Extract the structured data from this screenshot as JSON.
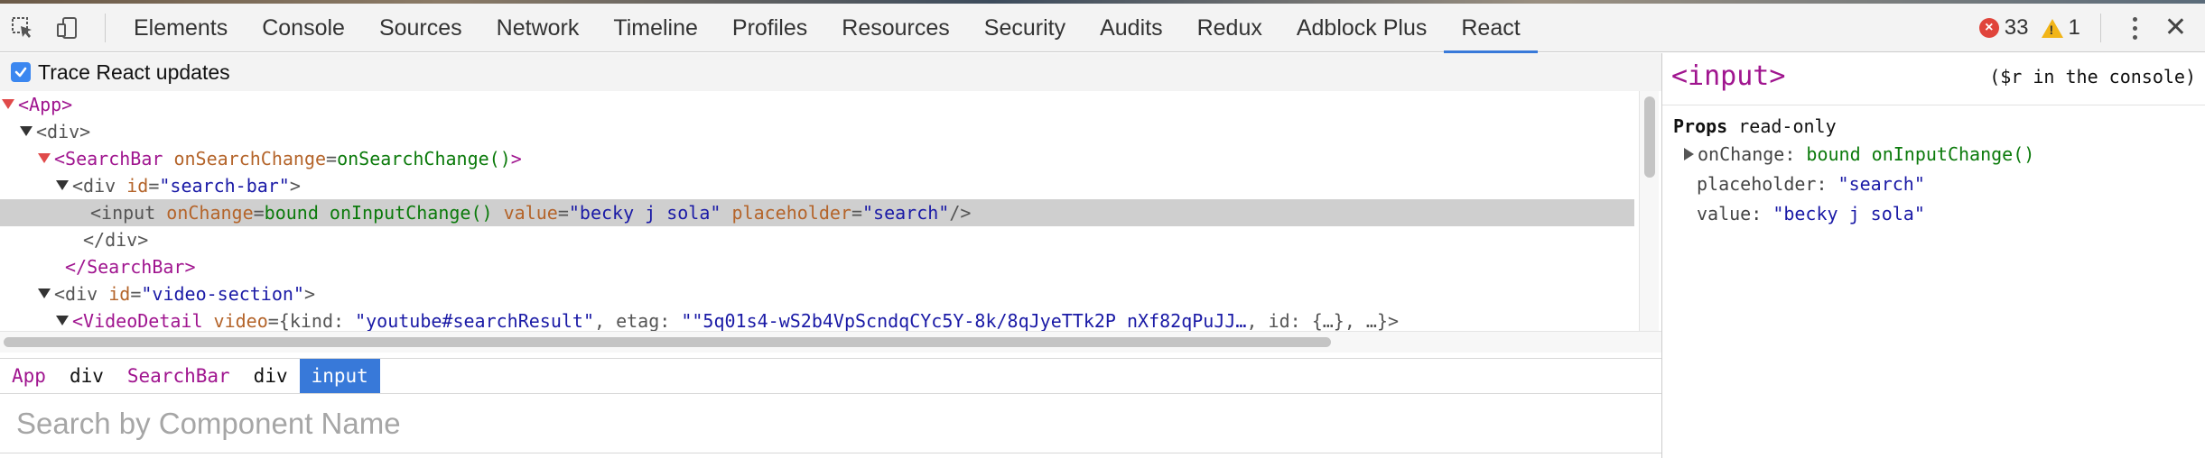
{
  "toolbar": {
    "tabs": [
      "Elements",
      "Console",
      "Sources",
      "Network",
      "Timeline",
      "Profiles",
      "Resources",
      "Security",
      "Audits",
      "Redux",
      "Adblock Plus",
      "React"
    ],
    "active_tab": "React",
    "error_count": "33",
    "warning_count": "1",
    "accent_color": "#3879d9"
  },
  "trace": {
    "label": "Trace React updates",
    "checked": true
  },
  "tree": {
    "nodes": [
      {
        "depth": 0,
        "arrow": "red",
        "parts": [
          [
            "tag",
            "<App>"
          ]
        ]
      },
      {
        "depth": 1,
        "arrow": "dark",
        "parts": [
          [
            "tagplain",
            "<div>"
          ]
        ]
      },
      {
        "depth": 2,
        "arrow": "red",
        "parts": [
          [
            "tag",
            "<SearchBar"
          ],
          [
            "sp",
            " "
          ],
          [
            "attr",
            "onSearchChange"
          ],
          [
            "punct",
            "="
          ],
          [
            "fn",
            "onSearchChange()"
          ],
          [
            "tag",
            ">"
          ]
        ]
      },
      {
        "depth": 3,
        "arrow": "dark",
        "parts": [
          [
            "tagplain",
            "<div"
          ],
          [
            "sp",
            " "
          ],
          [
            "attr",
            "id"
          ],
          [
            "punct",
            "="
          ],
          [
            "str",
            "\"search-bar\""
          ],
          [
            "tagplain",
            ">"
          ]
        ]
      },
      {
        "depth": 4,
        "arrow": "none",
        "selected": true,
        "parts": [
          [
            "tagplain",
            "<input"
          ],
          [
            "sp",
            " "
          ],
          [
            "attr",
            "onChange"
          ],
          [
            "punct",
            "="
          ],
          [
            "fn",
            "bound onInputChange()"
          ],
          [
            "sp",
            " "
          ],
          [
            "attr",
            "value"
          ],
          [
            "punct",
            "="
          ],
          [
            "str",
            "\"becky j sola\""
          ],
          [
            "sp",
            " "
          ],
          [
            "attr",
            "placeholder"
          ],
          [
            "punct",
            "="
          ],
          [
            "str",
            "\"search\""
          ],
          [
            "tagplain",
            "/>"
          ]
        ]
      },
      {
        "depth": 3.6,
        "arrow": "none",
        "parts": [
          [
            "tagplain",
            "</div>"
          ]
        ]
      },
      {
        "depth": 2.6,
        "arrow": "none",
        "parts": [
          [
            "tag",
            "</SearchBar>"
          ]
        ]
      },
      {
        "depth": 2,
        "arrow": "dark",
        "parts": [
          [
            "tagplain",
            "<div"
          ],
          [
            "sp",
            " "
          ],
          [
            "attr",
            "id"
          ],
          [
            "punct",
            "="
          ],
          [
            "str",
            "\"video-section\""
          ],
          [
            "tagplain",
            ">"
          ]
        ]
      },
      {
        "depth": 3,
        "arrow": "dark",
        "parts": [
          [
            "tag",
            "<VideoDetail"
          ],
          [
            "sp",
            " "
          ],
          [
            "attr",
            "video"
          ],
          [
            "punct",
            "={kind: "
          ],
          [
            "str",
            "\"youtube#searchResult\""
          ],
          [
            "punct",
            ", etag: "
          ],
          [
            "str",
            "\"\"5q01s4-wS2b4VpScndqCYc5Y-8k/8qJyeTTk2P_nXf82qPuJJ…"
          ],
          [
            "punct",
            ", id: {…}, …}>"
          ]
        ]
      }
    ]
  },
  "breadcrumb": [
    {
      "label": "App",
      "kind": "comp"
    },
    {
      "label": "div",
      "kind": "dom"
    },
    {
      "label": "SearchBar",
      "kind": "comp"
    },
    {
      "label": "div",
      "kind": "dom"
    },
    {
      "label": "input",
      "kind": "active"
    }
  ],
  "search": {
    "placeholder": "Search by Component Name"
  },
  "details": {
    "selected_name": "<input>",
    "console_hint": "($r in the console)",
    "props_title": "Props",
    "props_mode": "read-only",
    "props": [
      {
        "key": "onChange",
        "value": "bound onInputChange()",
        "expandable": true,
        "kind": "fn"
      },
      {
        "key": "placeholder",
        "value": "\"search\"",
        "expandable": false,
        "kind": "str"
      },
      {
        "key": "value",
        "value": "\"becky j sola\"",
        "expandable": false,
        "kind": "str"
      }
    ]
  }
}
